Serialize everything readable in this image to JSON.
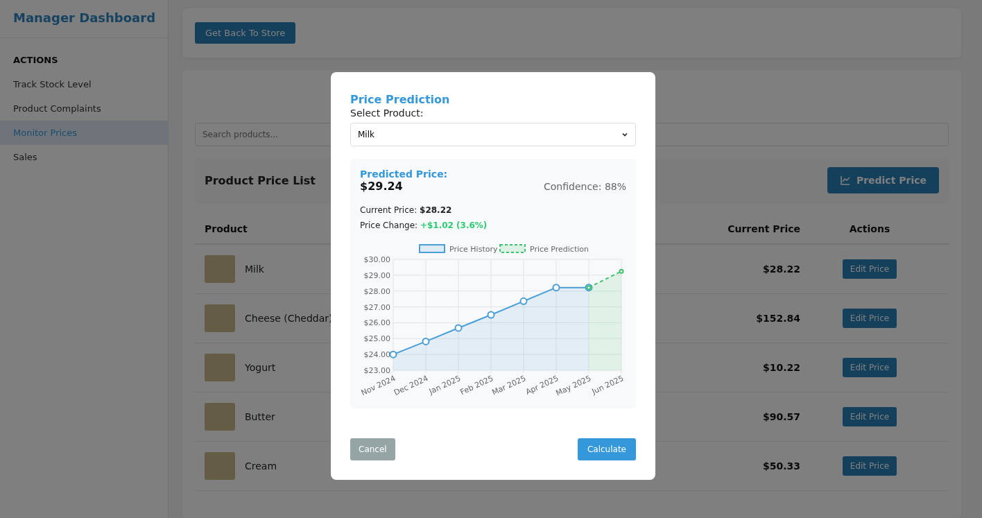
{
  "sidebar": {
    "title": "Manager Dashboard",
    "section": "ACTIONS",
    "items": [
      {
        "label": "Track Stock Level",
        "selected": false
      },
      {
        "label": "Product Complaints",
        "selected": false
      },
      {
        "label": "Monitor Prices",
        "selected": true
      },
      {
        "label": "Sales",
        "selected": false
      }
    ]
  },
  "top_bar": {
    "button": "Get Back To Store"
  },
  "search": {
    "placeholder": "Search products..."
  },
  "list_header": {
    "title": "Product Price List",
    "button": "Predict Price"
  },
  "table": {
    "columns": [
      "Product",
      "Current Price",
      "Actions"
    ],
    "rows": [
      {
        "product": "Milk",
        "price": "$28.22",
        "action": "Edit Price"
      },
      {
        "product": "Cheese (Cheddar)",
        "price": "$152.84",
        "action": "Edit Price"
      },
      {
        "product": "Yogurt",
        "price": "$10.22",
        "action": "Edit Price"
      },
      {
        "product": "Butter",
        "price": "$90.57",
        "action": "Edit Price"
      },
      {
        "product": "Cream",
        "price": "$50.33",
        "action": "Edit Price"
      }
    ]
  },
  "modal": {
    "title": "Price Prediction",
    "select_label": "Select Product:",
    "select_value": "Milk",
    "predicted_label": "Predicted Price:",
    "predicted_value": "$29.24",
    "confidence": "Confidence: 88%",
    "current_label": "Current Price:",
    "current_value": "$28.22",
    "change_label": "Price Change:",
    "change_value": "+$1.02 (3.6%)",
    "chart_data": {
      "type": "area",
      "grid": true,
      "legend": true,
      "categories": [
        "Nov 2024",
        "Dec 2024",
        "Jan 2025",
        "Feb 2025",
        "Mar 2025",
        "Apr 2025",
        "May 2025",
        "Jun 2025"
      ],
      "ylim": [
        23,
        30
      ],
      "yticks": [
        {
          "value": 23,
          "label": "$23.00"
        },
        {
          "value": 24,
          "label": "$24.00"
        },
        {
          "value": 25,
          "label": "$25.00"
        },
        {
          "value": 26,
          "label": "$26.00"
        },
        {
          "value": 27,
          "label": "$27.00"
        },
        {
          "value": 28,
          "label": "$28.00"
        },
        {
          "value": 29,
          "label": "$29.00"
        },
        {
          "value": 30,
          "label": "$30.00"
        }
      ],
      "series": [
        {
          "name": "Price History",
          "color": "#4a9fd8",
          "marker": "circle",
          "line_style": "solid",
          "values": [
            24.0,
            24.82,
            25.67,
            26.5,
            27.36,
            28.22,
            28.22,
            null
          ]
        },
        {
          "name": "Price Prediction",
          "color": "#3cc46e",
          "marker": "circle",
          "line_style": "dashed",
          "values": [
            null,
            null,
            null,
            null,
            null,
            null,
            28.22,
            29.24
          ]
        }
      ]
    },
    "cancel": "Cancel",
    "calculate": "Calculate"
  }
}
